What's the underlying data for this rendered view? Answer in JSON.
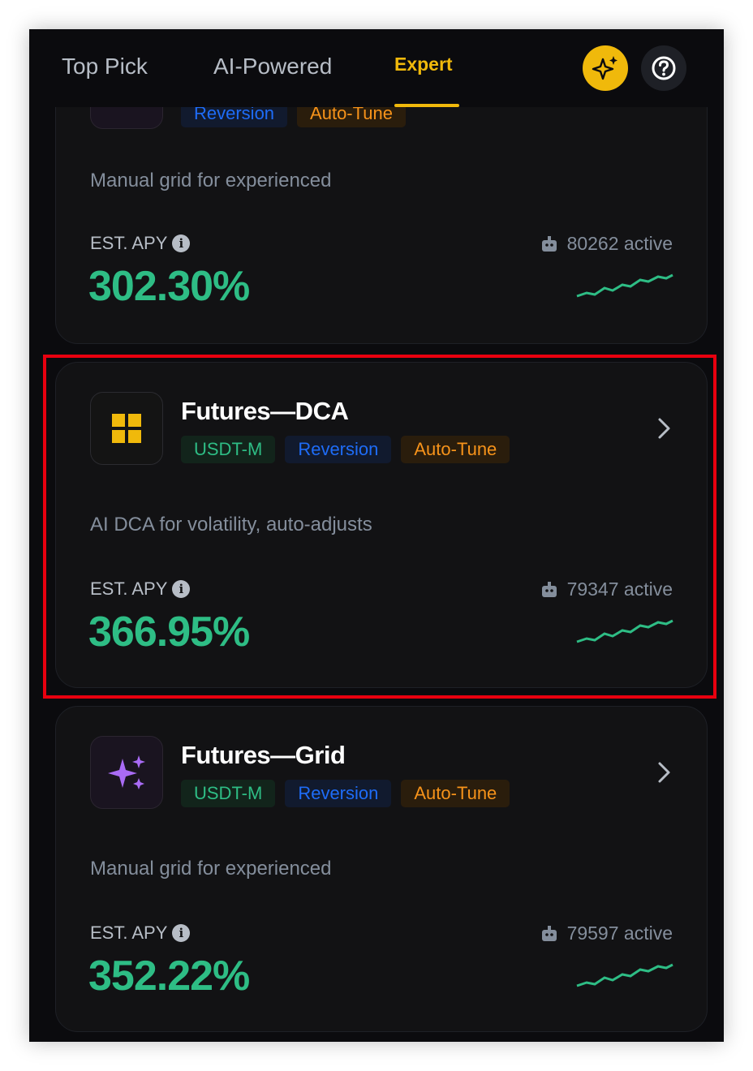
{
  "tabs": [
    {
      "label": "Top Pick"
    },
    {
      "label": "AI-Powered"
    },
    {
      "label": "Expert",
      "active": true
    }
  ],
  "header_icons": {
    "ai": "sparkle-icon",
    "help": "question-circle-icon"
  },
  "colors": {
    "accent": "#f0b90b",
    "positive": "#2ebd85",
    "tag_blue": "#1e6cf7",
    "tag_orange": "#f7931a",
    "highlight": "#e8000f"
  },
  "cards": [
    {
      "title": "",
      "tags": [
        "Reversion",
        "Auto-Tune"
      ],
      "description": "Manual grid for experienced",
      "apy_label": "EST. APY",
      "apy": "302.30%",
      "active": "80262 active"
    },
    {
      "title": "Futures—DCA",
      "icon": "grid-squares-icon",
      "tags": [
        "USDT-M",
        "Reversion",
        "Auto-Tune"
      ],
      "description": "AI DCA for volatility, auto-adjusts",
      "apy_label": "EST. APY",
      "apy": "366.95%",
      "active": "79347 active",
      "highlighted": true
    },
    {
      "title": "Futures—Grid",
      "icon": "sparkle-icon",
      "tags": [
        "USDT-M",
        "Reversion",
        "Auto-Tune"
      ],
      "description": "Manual grid for experienced",
      "apy_label": "EST. APY",
      "apy": "352.22%",
      "active": "79597 active"
    }
  ]
}
